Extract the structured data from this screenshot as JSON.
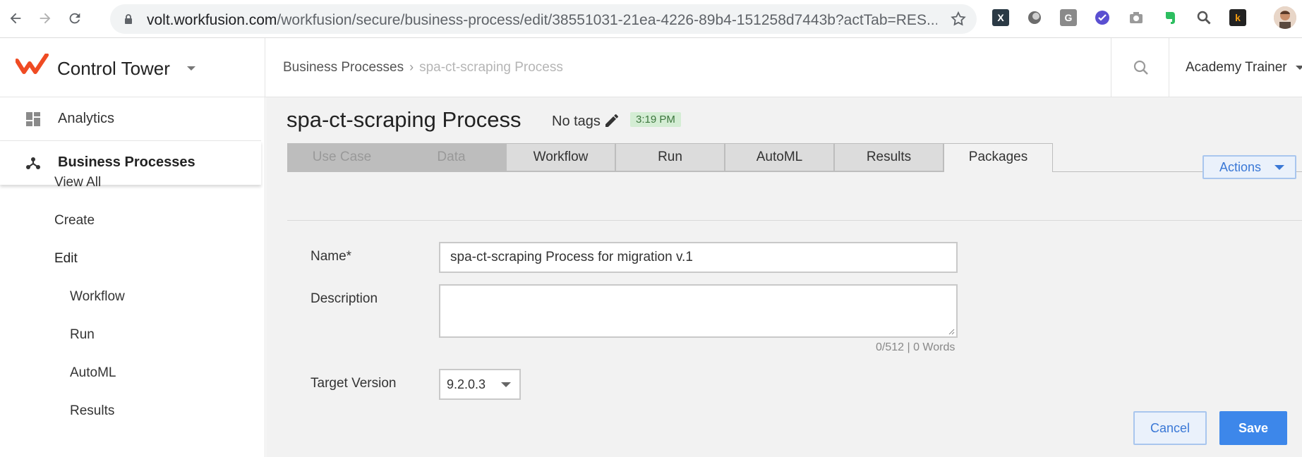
{
  "browser": {
    "url_host": "volt.workfusion.com",
    "url_path": "/workfusion/secure/business-process/edit/38551031-21ea-4226-89b4-151258d7443b?actTab=RES...",
    "extensions": [
      {
        "name": "x-extension-icon",
        "glyph": "X",
        "color": "#2b3a45"
      },
      {
        "name": "circle-extension-icon",
        "glyph": "",
        "color": "#6c6c6c"
      },
      {
        "name": "g-extension-icon",
        "glyph": "G",
        "color": "#8a8a8a"
      },
      {
        "name": "check-extension-icon",
        "glyph": "",
        "color": "#5a4fd1"
      },
      {
        "name": "camera-extension-icon",
        "glyph": "",
        "color": "#9a9a9a"
      },
      {
        "name": "evernote-extension-icon",
        "glyph": "",
        "color": "#2dbe60"
      },
      {
        "name": "magnifier-extension-icon",
        "glyph": "",
        "color": "#555555"
      },
      {
        "name": "k-extension-icon",
        "glyph": "k",
        "color": "#222222"
      }
    ]
  },
  "app": {
    "title": "Control Tower",
    "brand_color": "#ef4b23"
  },
  "breadcrumb": {
    "parent": "Business Processes",
    "current": "spa-ct-scraping Process"
  },
  "user": {
    "name": "Academy Trainer"
  },
  "sidebar": {
    "main_items": [
      {
        "label": "Analytics"
      },
      {
        "label": "Business Processes"
      }
    ],
    "sub_items": [
      {
        "label": "View All"
      },
      {
        "label": "Create"
      },
      {
        "label": "Edit"
      },
      {
        "label": "Workflow"
      },
      {
        "label": "Run"
      },
      {
        "label": "AutoML"
      },
      {
        "label": "Results"
      }
    ]
  },
  "page": {
    "title": "spa-ct-scraping Process",
    "tags_label": "No tags",
    "time": "3:19 PM"
  },
  "tabs": [
    {
      "label": "Use Case",
      "state": "disabled"
    },
    {
      "label": "Data",
      "state": "disabled"
    },
    {
      "label": "Workflow",
      "state": "normal"
    },
    {
      "label": "Run",
      "state": "normal"
    },
    {
      "label": "AutoML",
      "state": "normal"
    },
    {
      "label": "Results",
      "state": "normal"
    },
    {
      "label": "Packages",
      "state": "active"
    }
  ],
  "actions": {
    "label": "Actions"
  },
  "form": {
    "name_label": "Name*",
    "name_value": "spa-ct-scraping Process for migration v.1",
    "description_label": "Description",
    "description_value": "",
    "description_counter": "0/512 | 0 Words",
    "target_version_label": "Target Version",
    "target_version_value": "9.2.0.3",
    "cancel_label": "Cancel",
    "save_label": "Save"
  }
}
